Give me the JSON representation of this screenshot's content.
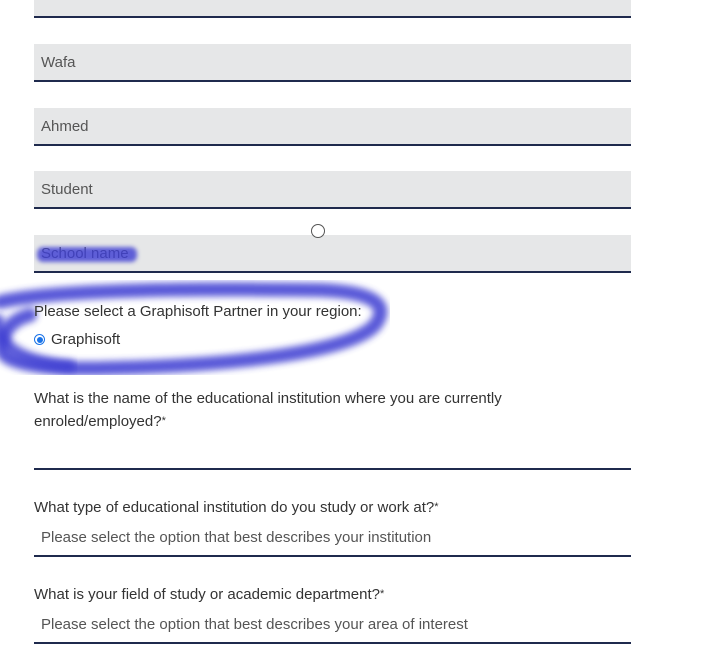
{
  "form": {
    "first_name": "Wafa",
    "last_name": "Ahmed",
    "role": "Student",
    "school_obscured": "School name",
    "partner_label": "Please select a Graphisoft Partner in your region:",
    "partner_option": "Graphisoft",
    "institution_question": "What is the name of the educational institution where you are currently enroled/employed?",
    "institution_required": "*",
    "institution_value": "",
    "type_question": "What type of educational institution do you study or work at?",
    "type_required": "*",
    "type_placeholder": "Please select the option that best describes your institution",
    "field_question": "What is your field of study or academic department?",
    "field_required": "*",
    "field_placeholder": "Please select the option that best describes your area of interest"
  },
  "colors": {
    "input_bg": "#e6e7e8",
    "underline": "#1f2a4d",
    "radio_accent": "#1a73e8",
    "scribble": "#3c3cd2"
  }
}
